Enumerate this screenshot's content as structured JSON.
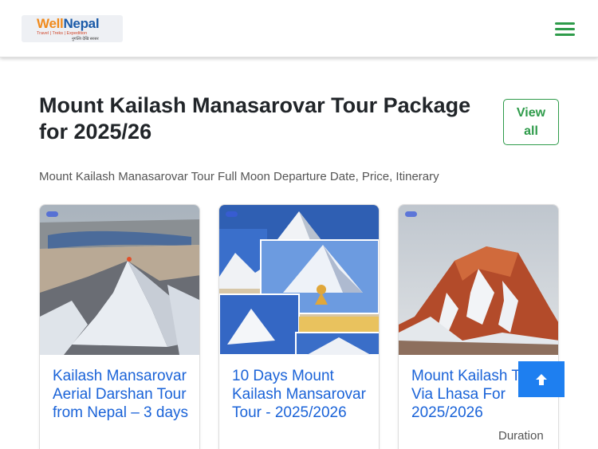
{
  "header": {
    "logo": {
      "word1": "Well",
      "word2": "Nepal",
      "tagline": "Travel | Treks | Expedition",
      "subline": "नुगल्ति देखि सरसर"
    }
  },
  "main": {
    "title": "Mount Kailash Manasarovar Tour Package for 2025/26",
    "view_all_label": "View all",
    "subtitle": "Mount Kailash Manasarovar Tour Full Moon Departure Date, Price, Itinerary"
  },
  "cards": [
    {
      "title": "Kailash Mansarovar Aerial Darshan Tour from Nepal – 3 days"
    },
    {
      "title": "10 Days Mount Kailash Mansarovar Tour - 2025/2026"
    },
    {
      "title": "Mount Kailash Tour Via Lhasa For 2025/2026",
      "duration_label": "Duration"
    }
  ],
  "icons": {
    "menu": "hamburger-icon",
    "scroll_top": "arrow-up-icon"
  },
  "colors": {
    "brand_green": "#2e9b4a",
    "link_blue": "#1a63d8",
    "button_blue": "#1e7ff0"
  }
}
